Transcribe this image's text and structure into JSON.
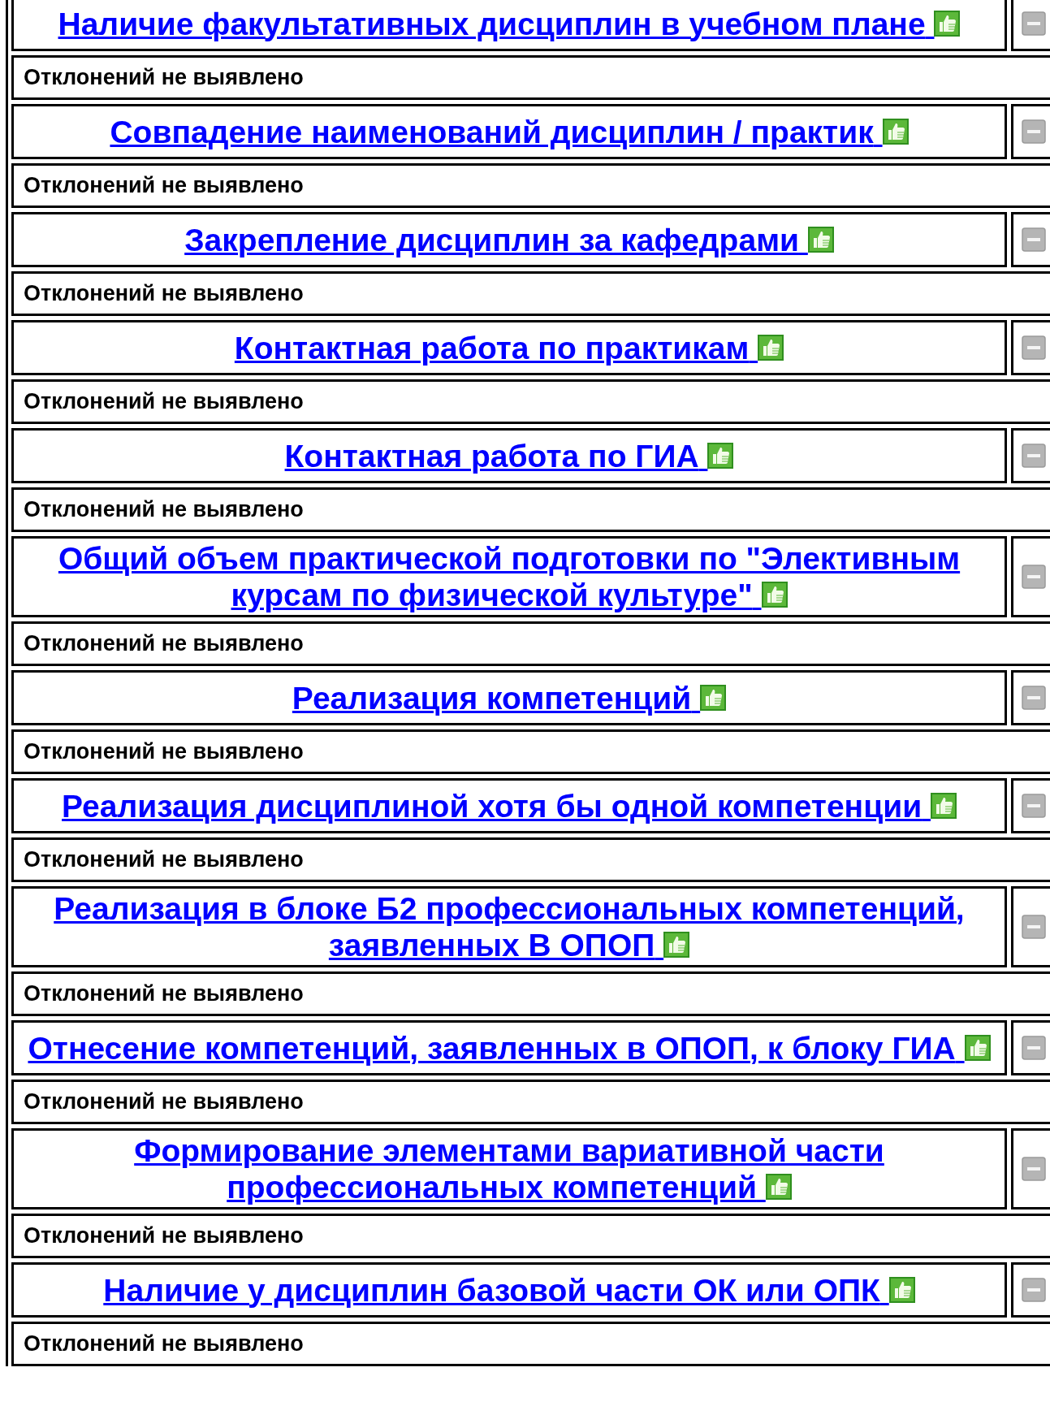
{
  "checks": [
    {
      "title": "Наличие факультативных дисциплин в учебном плане",
      "result": "Отклонений не выявлено"
    },
    {
      "title": "Совпадение наименований дисциплин / практик",
      "result": "Отклонений не выявлено"
    },
    {
      "title": "Закрепление дисциплин за кафедрами",
      "result": "Отклонений не выявлено"
    },
    {
      "title": "Контактная работа по практикам",
      "result": "Отклонений не выявлено"
    },
    {
      "title": "Контактная работа по ГИА",
      "result": "Отклонений не выявлено"
    },
    {
      "title": "Общий объем практической подготовки по \"Элективным курсам по физической культуре\"",
      "result": "Отклонений не выявлено"
    },
    {
      "title": "Реализация компетенций",
      "result": "Отклонений не выявлено"
    },
    {
      "title": "Реализация дисциплиной хотя бы одной компетенции",
      "result": "Отклонений не выявлено"
    },
    {
      "title": "Реализация в блоке Б2 профессиональных компетенций, заявленных В ОПОП",
      "result": "Отклонений не выявлено"
    },
    {
      "title": "Отнесение компетенций, заявленных в ОПОП, к блоку ГИА",
      "result": "Отклонений не выявлено"
    },
    {
      "title": "Формирование элементами вариативной части профессиональных компетенций",
      "result": "Отклонений не выявлено"
    },
    {
      "title": "Наличие у дисциплин базовой части ОК или ОПК",
      "result": "Отклонений не выявлено"
    }
  ]
}
